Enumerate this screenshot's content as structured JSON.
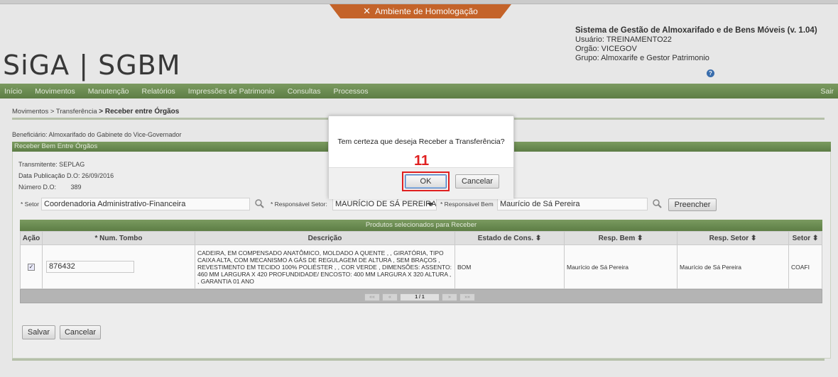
{
  "environment": {
    "label": "Ambiente de Homologação",
    "icon": "tools-icon"
  },
  "logo": {
    "text": "SiGA | SGBM"
  },
  "system": {
    "title": "Sistema de Gestão de Almoxarifado e de Bens Móveis (v. 1.04)",
    "usuario": "Usuário: TREINAMENTO22",
    "orgao": "Orgão: VICEGOV",
    "grupo": "Grupo: Almoxarife e Gestor Patrimonio"
  },
  "nav": {
    "items": [
      "Início",
      "Movimentos",
      "Manutenção",
      "Relatórios",
      "Impressões de Patrimonio",
      "Consultas",
      "Processos"
    ],
    "logout": "Sair"
  },
  "breadcrumb": {
    "p1": "Movimentos",
    "p2": "> Transferência",
    "p3": "> Receber entre Órgãos"
  },
  "beneficiario": "Beneficiário: Almoxarifado do Gabinete do Vice-Governador",
  "panel": {
    "title": "Receber Bem Entre Órgãos",
    "transmitente": "Transmitente: SEPLAG",
    "data_publicacao": "Data Publicação D.O: 26/09/2016",
    "numero_do_label": "Número D.O:",
    "numero_do_value": "389"
  },
  "form": {
    "setor_label": "* Setor",
    "setor_value": "Coordenadoria Administrativo-Financeira",
    "resp_setor_label": "* Responsável Setor:",
    "resp_setor_value": "MAURÍCIO DE SÁ PEREIRA",
    "resp_bem_label": "* Responsável Bem",
    "resp_bem_value": "Maurício de Sá Pereira",
    "preencher": "Preencher"
  },
  "grid": {
    "title": "Produtos selecionados para Receber",
    "headers": [
      "Ação",
      "* Num. Tombo",
      "Descrição",
      "Estado de Cons. ⬍",
      "Resp. Bem ⬍",
      "Resp. Setor ⬍",
      "Setor ⬍"
    ],
    "row": {
      "checked": true,
      "tombo": "876432",
      "descricao": "CADEIRA, EM COMPENSADO ANATÔMICO, MOLDADO A QUENTE , , GIRATÓRIA, TIPO CAIXA ALTA, COM MECANISMO A GÁS DE REGULAGEM DE ALTURA , SEM BRAÇOS , REVESTIMENTO EM TECIDO 100% POLIÉSTER , , COR VERDE , DIMENSÕES: ASSENTO: 460 MM LARGURA X 420 PROFUNDIDADE/ ENCOSTO: 400 MM LARGURA X 320 ALTURA , , GARANTIA 01 ANO",
      "estado": "BOM",
      "resp_bem": "Maurício de Sá Pereira",
      "resp_setor": "Maurício de Sá Pereira",
      "setor": "COAFI"
    },
    "pager": {
      "first": "«« ",
      "prev": "« ",
      "page": "1 / 1",
      "next": " »",
      "last": " »»"
    }
  },
  "actions": {
    "salvar": "Salvar",
    "cancelar": "Cancelar"
  },
  "dialog": {
    "message": "Tem certeza que deseja Receber a Transferência?",
    "ok": "OK",
    "cancel": "Cancelar",
    "step_number": "11"
  },
  "colors": {
    "nav_green": "#5f8047",
    "env_orange": "#c8652a",
    "highlight_red": "#e02020"
  }
}
